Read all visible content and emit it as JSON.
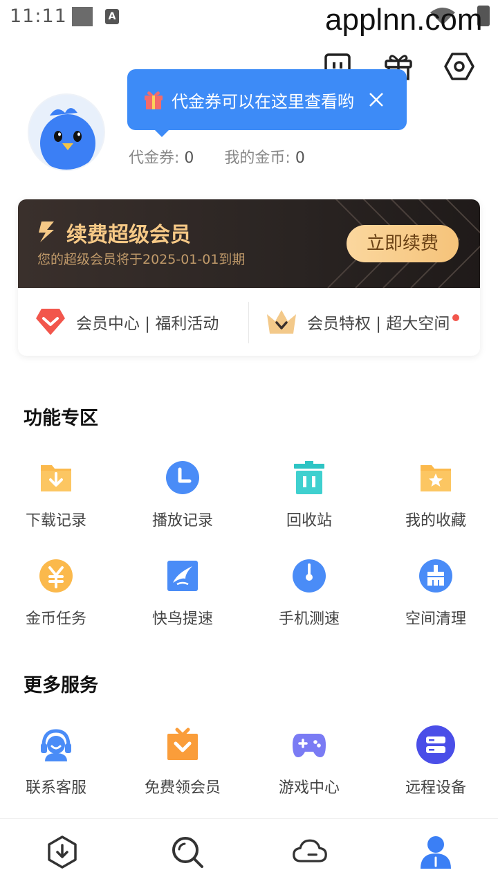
{
  "status_bar": {
    "time": "11:11",
    "watermark": "applnn.com"
  },
  "tooltip": {
    "text": "代金券可以在这里查看哟"
  },
  "stats": {
    "voucher_label": "代金券: ",
    "voucher_value": "0",
    "coin_label": "我的金币: ",
    "coin_value": "0"
  },
  "vip": {
    "title": "续费超级会员",
    "subtitle": "您的超级会员将于2025-01-01到期",
    "button": "立即续费",
    "link1": "会员中心 | 福利活动",
    "link2": "会员特权 | 超大空间"
  },
  "features": {
    "title": "功能专区",
    "items": [
      {
        "label": "下载记录",
        "icon": "download-folder-icon"
      },
      {
        "label": "播放记录",
        "icon": "clock-icon"
      },
      {
        "label": "回收站",
        "icon": "trash-icon"
      },
      {
        "label": "我的收藏",
        "icon": "star-folder-icon"
      },
      {
        "label": "金币任务",
        "icon": "coin-icon"
      },
      {
        "label": "快鸟提速",
        "icon": "bird-speed-icon"
      },
      {
        "label": "手机测速",
        "icon": "speed-gauge-icon"
      },
      {
        "label": "空间清理",
        "icon": "broom-icon"
      }
    ]
  },
  "services": {
    "title": "更多服务",
    "items": [
      {
        "label": "联系客服",
        "icon": "headset-icon"
      },
      {
        "label": "免费领会员",
        "icon": "gift-box-icon"
      },
      {
        "label": "游戏中心",
        "icon": "gamepad-icon"
      },
      {
        "label": "远程设备",
        "icon": "server-icon"
      }
    ]
  },
  "colors": {
    "accent_blue": "#3d8bf7",
    "vip_gold": "#f6c986",
    "orange": "#fbb94c",
    "teal": "#2ec4c4"
  }
}
